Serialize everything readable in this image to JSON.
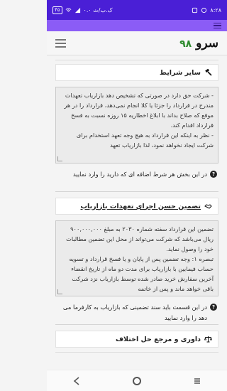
{
  "status_bar": {
    "time": "۸:۲۸",
    "net_speed": "۰.۰ ک.ب/ث",
    "battery": "۴۵"
  },
  "header": {
    "logo_word": "سرو",
    "logo_number": "۹۸"
  },
  "sections": {
    "other_terms": {
      "title": "سایر شرایط",
      "body": "- شرکت حق دارد در صورتی که تشخیص دهد بازاریاب تعهدات مندرج در قرارداد را جزئا یا کلا انجام نمی‌دهد، قرارداد را در هر موقع که صلاح بداند با ابلاغ اخطاریه ۱۵ روزه نسبت به فسخ قرارداد اقدام کند.\n- نظر به اینکه این قرارداد به هیچ وجه تعهد استخدام برای شرکت ایجاد نخواهد نمود، لذا بازاریاب تعهد",
      "hint": "در این بخش هر شرط اضافه ای که دارید را وارد نمایید"
    },
    "guarantee": {
      "title": "تضمین حسن اجرای تعهدات بازاریاب",
      "body": "تضمین این قرارداد سفته شماره ۲۰۳۰ به مبلغ ۹۰۰,۰۰۰,۰۰۰ ریال می‌باشد که شرکت می‌تواند از محل این تضمین مطالبات خود را وصول نماید.\nتبصره ۱: وجه تضمین پس از پایان و یا فسخ قرارداد و تسویه حساب فیمابین با بازاریاب برای مدت دو ماه از تاریخ انقضاء آخرین سفارش خرید صادر شده توسط بازاریاب نزد شرکت باقی خواهد ماند و پس از خاتمه",
      "hint": "در این قسمت باید سند تضمینی که بازاریاب به کارفرما می دهد را وارد نمایید"
    },
    "arbitration": {
      "title": "داوری و مرجع حل اختلاف"
    }
  }
}
